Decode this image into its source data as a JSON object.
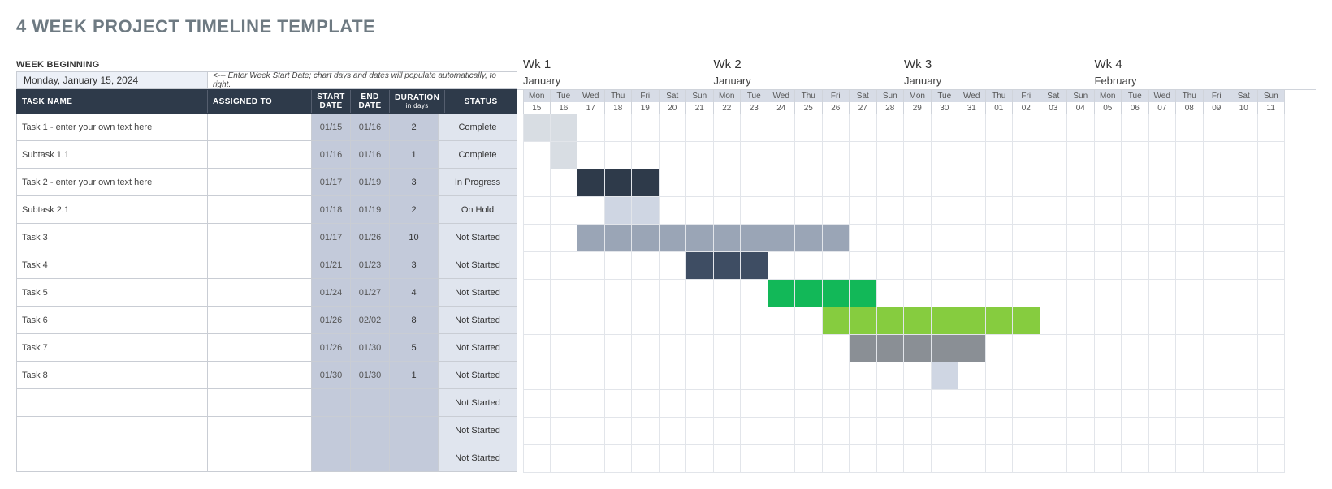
{
  "title": "4 WEEK PROJECT TIMELINE TEMPLATE",
  "week_beginning_label": "WEEK BEGINNING",
  "week_beginning_date": "Monday, January 15, 2024",
  "week_beginning_note": "<--- Enter Week Start Date; chart days and dates will populate automatically, to right.",
  "headers": {
    "task": "TASK NAME",
    "assigned": "ASSIGNED TO",
    "start": "START\nDATE",
    "end": "END\nDATE",
    "duration": "DURATION",
    "duration_sub": "in days",
    "status": "STATUS"
  },
  "weeks": [
    {
      "label": "Wk 1",
      "month": "January"
    },
    {
      "label": "Wk 2",
      "month": "January"
    },
    {
      "label": "Wk 3",
      "month": "January"
    },
    {
      "label": "Wk 4",
      "month": "February"
    }
  ],
  "days": [
    "Mon",
    "Tue",
    "Wed",
    "Thu",
    "Fri",
    "Sat",
    "Sun",
    "Mon",
    "Tue",
    "Wed",
    "Thu",
    "Fri",
    "Sat",
    "Sun",
    "Mon",
    "Tue",
    "Wed",
    "Thu",
    "Fri",
    "Sat",
    "Sun",
    "Mon",
    "Tue",
    "Wed",
    "Thu",
    "Fri",
    "Sat",
    "Sun"
  ],
  "dates": [
    "15",
    "16",
    "17",
    "18",
    "19",
    "20",
    "21",
    "22",
    "23",
    "24",
    "25",
    "26",
    "27",
    "28",
    "29",
    "30",
    "31",
    "01",
    "02",
    "03",
    "04",
    "05",
    "06",
    "07",
    "08",
    "09",
    "10",
    "11"
  ],
  "tasks": [
    {
      "name": "Task 1 - enter your own text here",
      "assigned": "",
      "start": "01/15",
      "end": "01/16",
      "dur": "2",
      "status": "Complete",
      "bar_start": 0,
      "bar_len": 2,
      "color": "c-lgtgrey"
    },
    {
      "name": "Subtask 1.1",
      "assigned": "",
      "start": "01/16",
      "end": "01/16",
      "dur": "1",
      "status": "Complete",
      "bar_start": 1,
      "bar_len": 1,
      "color": "c-lgtgrey"
    },
    {
      "name": "Task 2 - enter your own text here",
      "assigned": "",
      "start": "01/17",
      "end": "01/19",
      "dur": "3",
      "status": "In Progress",
      "bar_start": 2,
      "bar_len": 3,
      "color": "c-dark"
    },
    {
      "name": "Subtask 2.1",
      "assigned": "",
      "start": "01/18",
      "end": "01/19",
      "dur": "2",
      "status": "On Hold",
      "bar_start": 3,
      "bar_len": 2,
      "color": "c-ltblue"
    },
    {
      "name": "Task 3",
      "assigned": "",
      "start": "01/17",
      "end": "01/26",
      "dur": "10",
      "status": "Not Started",
      "bar_start": 2,
      "bar_len": 10,
      "color": "c-slate"
    },
    {
      "name": "Task 4",
      "assigned": "",
      "start": "01/21",
      "end": "01/23",
      "dur": "3",
      "status": "Not Started",
      "bar_start": 6,
      "bar_len": 3,
      "color": "c-navy"
    },
    {
      "name": "Task 5",
      "assigned": "",
      "start": "01/24",
      "end": "01/27",
      "dur": "4",
      "status": "Not Started",
      "bar_start": 9,
      "bar_len": 4,
      "color": "c-green"
    },
    {
      "name": "Task 6",
      "assigned": "",
      "start": "01/26",
      "end": "02/02",
      "dur": "8",
      "status": "Not Started",
      "bar_start": 11,
      "bar_len": 8,
      "color": "c-lime"
    },
    {
      "name": "Task 7",
      "assigned": "",
      "start": "01/26",
      "end": "01/30",
      "dur": "5",
      "status": "Not Started",
      "bar_start": 12,
      "bar_len": 5,
      "color": "c-grey"
    },
    {
      "name": "Task 8",
      "assigned": "",
      "start": "01/30",
      "end": "01/30",
      "dur": "1",
      "status": "Not Started",
      "bar_start": 15,
      "bar_len": 1,
      "color": "c-pale"
    },
    {
      "name": "",
      "assigned": "",
      "start": "",
      "end": "",
      "dur": "",
      "status": "Not Started",
      "bar_start": -1,
      "bar_len": 0,
      "color": ""
    },
    {
      "name": "",
      "assigned": "",
      "start": "",
      "end": "",
      "dur": "",
      "status": "Not Started",
      "bar_start": -1,
      "bar_len": 0,
      "color": ""
    },
    {
      "name": "",
      "assigned": "",
      "start": "",
      "end": "",
      "dur": "",
      "status": "Not Started",
      "bar_start": -1,
      "bar_len": 0,
      "color": ""
    }
  ],
  "chart_data": {
    "type": "table",
    "title": "4 Week Project Timeline Template",
    "x": [
      "2024-01-15",
      "2024-01-16",
      "2024-01-17",
      "2024-01-18",
      "2024-01-19",
      "2024-01-20",
      "2024-01-21",
      "2024-01-22",
      "2024-01-23",
      "2024-01-24",
      "2024-01-25",
      "2024-01-26",
      "2024-01-27",
      "2024-01-28",
      "2024-01-29",
      "2024-01-30",
      "2024-01-31",
      "2024-02-01",
      "2024-02-02",
      "2024-02-03",
      "2024-02-04",
      "2024-02-05",
      "2024-02-06",
      "2024-02-07",
      "2024-02-08",
      "2024-02-09",
      "2024-02-10",
      "2024-02-11"
    ],
    "series": [
      {
        "name": "Task 1 - enter your own text here",
        "start": "2024-01-15",
        "end": "2024-01-16",
        "duration_days": 2,
        "status": "Complete",
        "color": "#d8dde3"
      },
      {
        "name": "Subtask 1.1",
        "start": "2024-01-16",
        "end": "2024-01-16",
        "duration_days": 1,
        "status": "Complete",
        "color": "#d8dde3"
      },
      {
        "name": "Task 2 - enter your own text here",
        "start": "2024-01-17",
        "end": "2024-01-19",
        "duration_days": 3,
        "status": "In Progress",
        "color": "#2e3a4a"
      },
      {
        "name": "Subtask 2.1",
        "start": "2024-01-18",
        "end": "2024-01-19",
        "duration_days": 2,
        "status": "On Hold",
        "color": "#cfd6e3"
      },
      {
        "name": "Task 3",
        "start": "2024-01-17",
        "end": "2024-01-26",
        "duration_days": 10,
        "status": "Not Started",
        "color": "#9aa5b6"
      },
      {
        "name": "Task 4",
        "start": "2024-01-21",
        "end": "2024-01-23",
        "duration_days": 3,
        "status": "Not Started",
        "color": "#3e4d63"
      },
      {
        "name": "Task 5",
        "start": "2024-01-24",
        "end": "2024-01-27",
        "duration_days": 4,
        "status": "Not Started",
        "color": "#12b858"
      },
      {
        "name": "Task 6",
        "start": "2024-01-26",
        "end": "2024-02-02",
        "duration_days": 8,
        "status": "Not Started",
        "color": "#86cc3f"
      },
      {
        "name": "Task 7",
        "start": "2024-01-26",
        "end": "2024-01-30",
        "duration_days": 5,
        "status": "Not Started",
        "color": "#8a8f95"
      },
      {
        "name": "Task 8",
        "start": "2024-01-30",
        "end": "2024-01-30",
        "duration_days": 1,
        "status": "Not Started",
        "color": "#cfd6e3"
      }
    ]
  }
}
